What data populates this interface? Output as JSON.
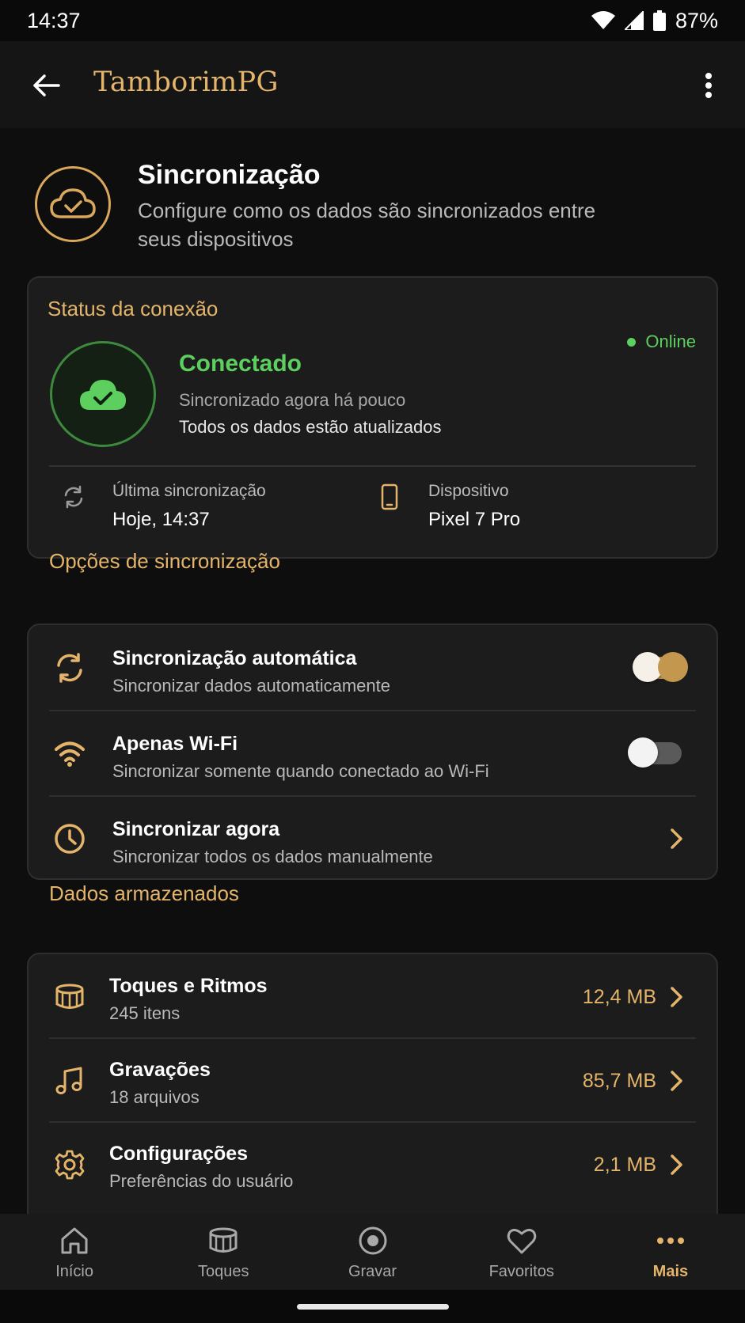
{
  "status_bar": {
    "time": "14:37",
    "battery": "87%"
  },
  "app_bar": {
    "title": "TamborimPG"
  },
  "header": {
    "title": "Sincronização",
    "subtitle": "Configure como os dados são sincronizados entre seus dispositivos"
  },
  "connection": {
    "section_label": "Status da conexão",
    "state": "Conectado",
    "detail": "Sincronizado agora há pouco",
    "detail2": "Todos os dados estão atualizados",
    "online_label": "Online",
    "last_sync_label": "Última sincronização",
    "last_sync_value": "Hoje, 14:37",
    "device_label": "Dispositivo",
    "device_value": "Pixel 7 Pro"
  },
  "options": {
    "section_label": "Opções de sincronização",
    "items": [
      {
        "title": "Sincronização automática",
        "subtitle": "Sincronizar dados automaticamente",
        "toggle": true
      },
      {
        "title": "Apenas Wi-Fi",
        "subtitle": "Sincronizar somente quando conectado ao Wi-Fi",
        "toggle": false
      },
      {
        "title": "Sincronizar agora",
        "subtitle": "Sincronizar todos os dados manualmente"
      }
    ]
  },
  "stored": {
    "section_label": "Dados armazenados",
    "items": [
      {
        "title": "Toques e Ritmos",
        "subtitle": "245 itens",
        "size": "12,4 MB"
      },
      {
        "title": "Gravações",
        "subtitle": "18 arquivos",
        "size": "85,7 MB"
      },
      {
        "title": "Configurações",
        "subtitle": "Preferências do usuário",
        "size": "2,1 MB"
      }
    ]
  },
  "nav": {
    "items": [
      {
        "label": "Início",
        "icon": "home-icon"
      },
      {
        "label": "Toques",
        "icon": "drum-icon"
      },
      {
        "label": "Gravar",
        "icon": "record-icon"
      },
      {
        "label": "Favoritos",
        "icon": "heart-icon"
      },
      {
        "label": "Mais",
        "icon": "more-horizontal-icon",
        "active": true
      }
    ]
  },
  "colors": {
    "accent": "#e3b46a",
    "success": "#5ccf5e",
    "background": "#0e0e0e",
    "card": "#1c1c1c"
  }
}
